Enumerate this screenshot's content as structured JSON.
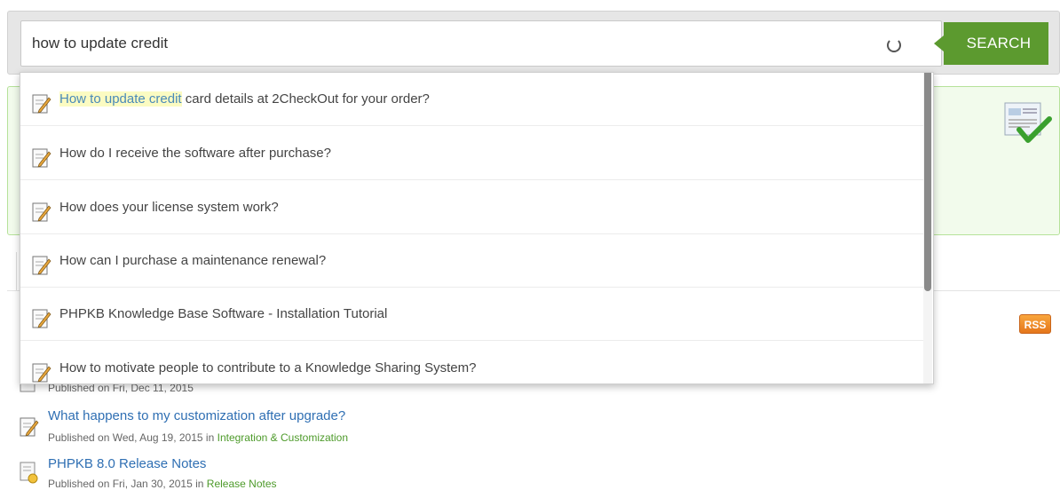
{
  "search": {
    "value": "how to update credit",
    "button_label": "SEARCH"
  },
  "suggestions": [
    {
      "highlight": "How to update credit",
      "rest": " card details at 2CheckOut for your order?"
    },
    {
      "highlight": "",
      "rest": "How do I receive the software after purchase?"
    },
    {
      "highlight": "",
      "rest": "How does your license system work?"
    },
    {
      "highlight": "",
      "rest": "How can I purchase a maintenance renewal?"
    },
    {
      "highlight": "",
      "rest": "PHPKB Knowledge Base Software - Installation Tutorial"
    },
    {
      "highlight": "",
      "rest": "How to motivate people to contribute to a Knowledge Sharing System?"
    }
  ],
  "feed": {
    "rss_label": "RSS"
  },
  "articles": [
    {
      "title": "",
      "meta_prefix": "Published on Fri, Dec 11, 2015",
      "meta_in": "",
      "category": ""
    },
    {
      "title": "What happens to my customization after upgrade?",
      "meta_prefix": "Published on Wed, Aug 19, 2015",
      "meta_in": " in ",
      "category": "Integration & Customization"
    },
    {
      "title": "PHPKB 8.0 Release Notes",
      "meta_prefix": "Published on Fri, Jan 30, 2015",
      "meta_in": " in ",
      "category": "Release Notes"
    }
  ],
  "colors": {
    "search_button": "#5c9a2f",
    "highlight_bg": "#fbfbc2",
    "link": "#2f6fb3",
    "category_link": "#4d9a2a",
    "panel_bg": "#f2fbec"
  },
  "icons": {
    "suggestion": "edit-document-icon",
    "spinner": "loading-spinner-icon",
    "panel": "document-checkmark-icon",
    "feed": "rss-icon"
  }
}
